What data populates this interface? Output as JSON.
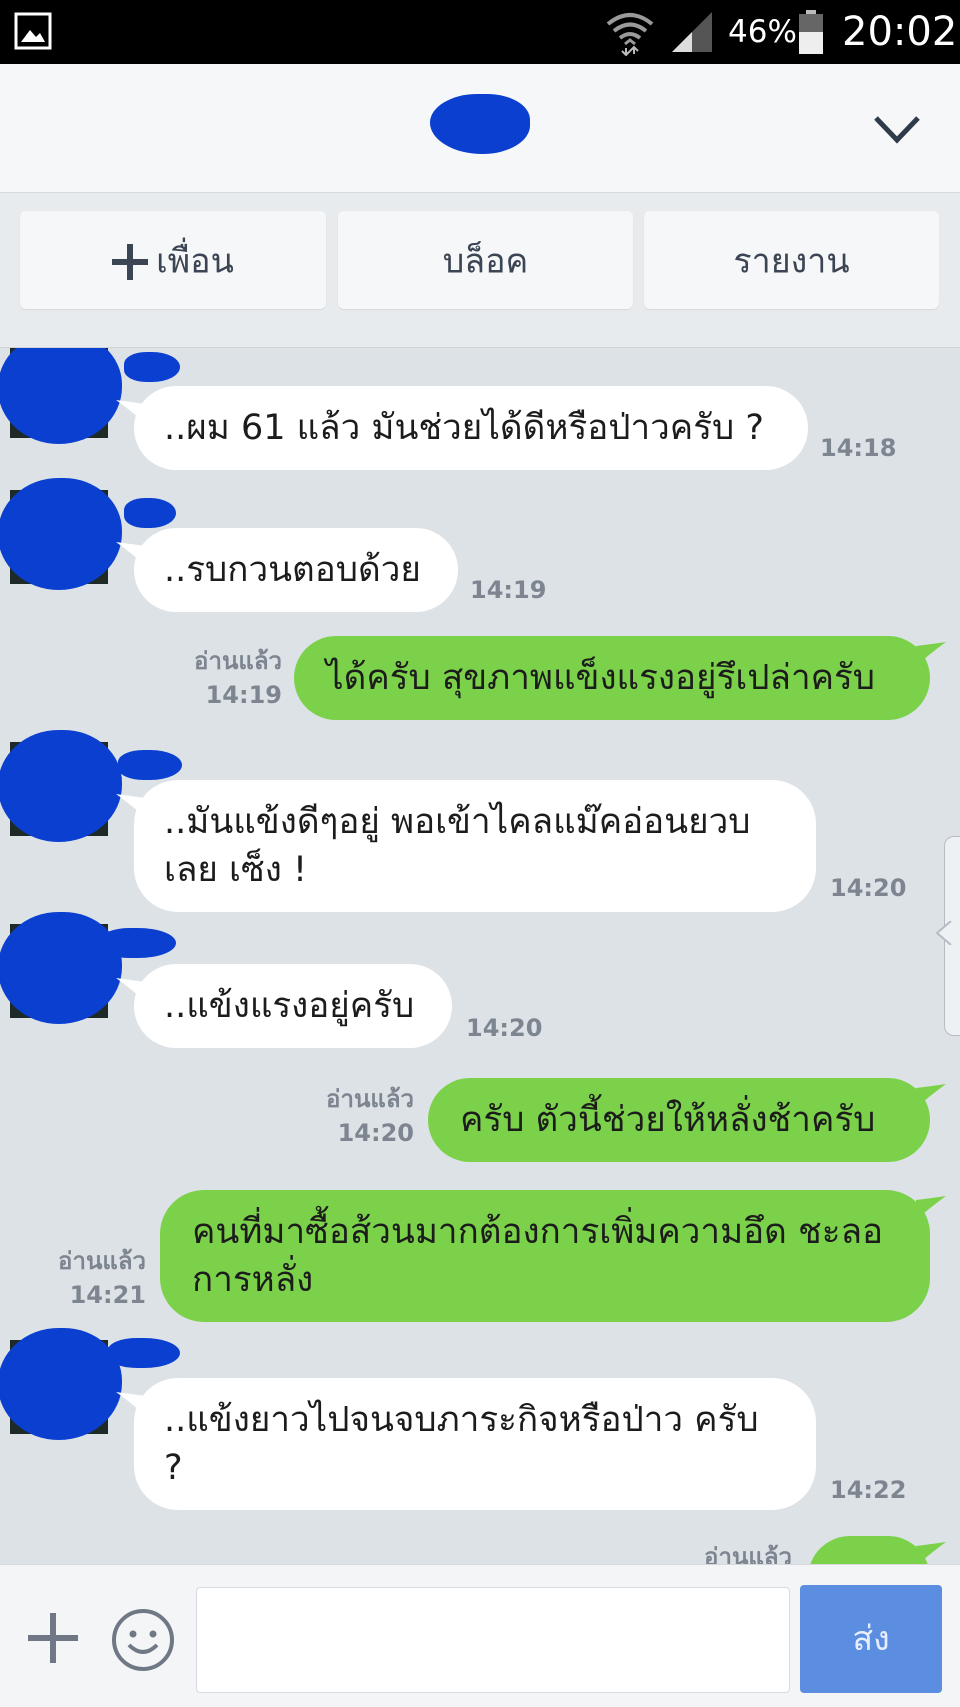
{
  "status_bar": {
    "battery_percent": "46%",
    "time": "20:02",
    "icons": [
      "image-icon",
      "wifi-icon",
      "signal-icon",
      "battery-icon"
    ]
  },
  "header": {
    "contact_name": "",
    "icons": [
      "chevron-down-icon"
    ]
  },
  "actions": {
    "add_friend": "เพื่อน",
    "block": "บล็อค",
    "report": "รายงาน"
  },
  "messages": [
    {
      "side": "in",
      "text": "..ผม 61 แล้ว มันช่วยได้ดีหรือป่าวครับ ?",
      "time": "14:18"
    },
    {
      "side": "in",
      "text": "..รบกวนตอบด้วย",
      "time": "14:19"
    },
    {
      "side": "out",
      "text": "ได้ครับ สุขภาพแข็งแรงอยู่รึเปล่าครับ",
      "read": "อ่านแล้ว",
      "time": "14:19"
    },
    {
      "side": "in",
      "text": "..มันแข้งดีๆอยู่ พอเข้าไคลแม๊คอ่อนยวบ เลย เซ็ง !",
      "time": "14:20"
    },
    {
      "side": "in",
      "text": "..แข้งแรงอยู่ครับ",
      "time": "14:20"
    },
    {
      "side": "out",
      "text": "ครับ ตัวนี้ช่วยให้หลั่งช้าครับ",
      "read": "อ่านแล้ว",
      "time": "14:20"
    },
    {
      "side": "out",
      "text": "คนที่มาซื้อส้วนมากต้องการเพิ่มความอึด ชะลอการหลั่ง",
      "read": "อ่านแล้ว",
      "time": "14:21"
    },
    {
      "side": "in",
      "text": "..แข้งยาวไปจนจบภาระกิจหรือป่าว ครับ ?",
      "time": "14:22"
    },
    {
      "side": "out",
      "text": "",
      "read": "อ่านแล้ว",
      "time": ""
    }
  ],
  "input": {
    "placeholder": "",
    "send_label": "ส่ง",
    "icons": [
      "plus-icon",
      "emoji-icon"
    ]
  },
  "colors": {
    "status_bar": "#000000",
    "chat_background": "#dde2e7",
    "incoming_bubble": "#ffffff",
    "outgoing_bubble": "#7bd24a",
    "send_button": "#5b8ee0",
    "redaction": "#0a3fd0"
  }
}
